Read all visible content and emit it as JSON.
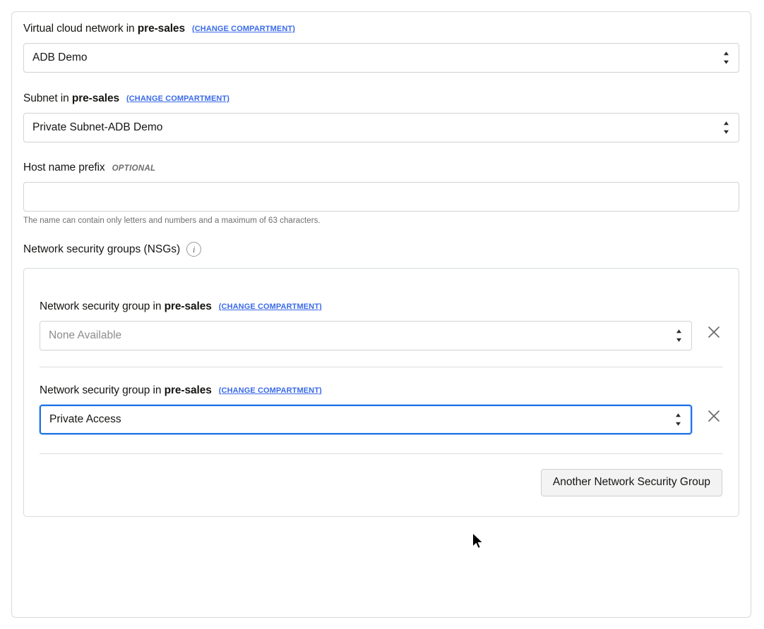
{
  "form": {
    "vcn": {
      "label_prefix": "Virtual cloud network in",
      "label_compartment": "pre-sales",
      "change_link": "(CHANGE COMPARTMENT)",
      "value": "ADB Demo"
    },
    "subnet": {
      "label_prefix": "Subnet in",
      "label_compartment": "pre-sales",
      "change_link": "(CHANGE COMPARTMENT)",
      "value": "Private Subnet-ADB Demo"
    },
    "host_name_prefix": {
      "label": "Host name prefix",
      "optional_tag": "OPTIONAL",
      "value": "",
      "placeholder": "",
      "helper_text": "The name can contain only letters and numbers and a maximum of 63 characters."
    },
    "nsg_section": {
      "title": "Network security groups (NSGs)",
      "info_icon": "info-icon",
      "rows": [
        {
          "label_prefix": "Network security group in",
          "label_compartment": "pre-sales",
          "change_link": "(CHANGE COMPARTMENT)",
          "value": "None Available",
          "is_placeholder": true,
          "focused": false,
          "remove_icon": "close-icon"
        },
        {
          "label_prefix": "Network security group in",
          "label_compartment": "pre-sales",
          "change_link": "(CHANGE COMPARTMENT)",
          "value": "Private Access",
          "is_placeholder": false,
          "focused": true,
          "remove_icon": "close-icon"
        }
      ],
      "add_button_label": "Another Network Security Group"
    }
  },
  "colors": {
    "link": "#3a6ae8",
    "focus_border": "#1e73e8",
    "border": "#d3d3d3",
    "panel_border": "#d5dbdb",
    "text": "#161513",
    "muted": "#6f6f6f",
    "placeholder": "#8d8d8d",
    "button_bg": "#f3f3f3"
  }
}
